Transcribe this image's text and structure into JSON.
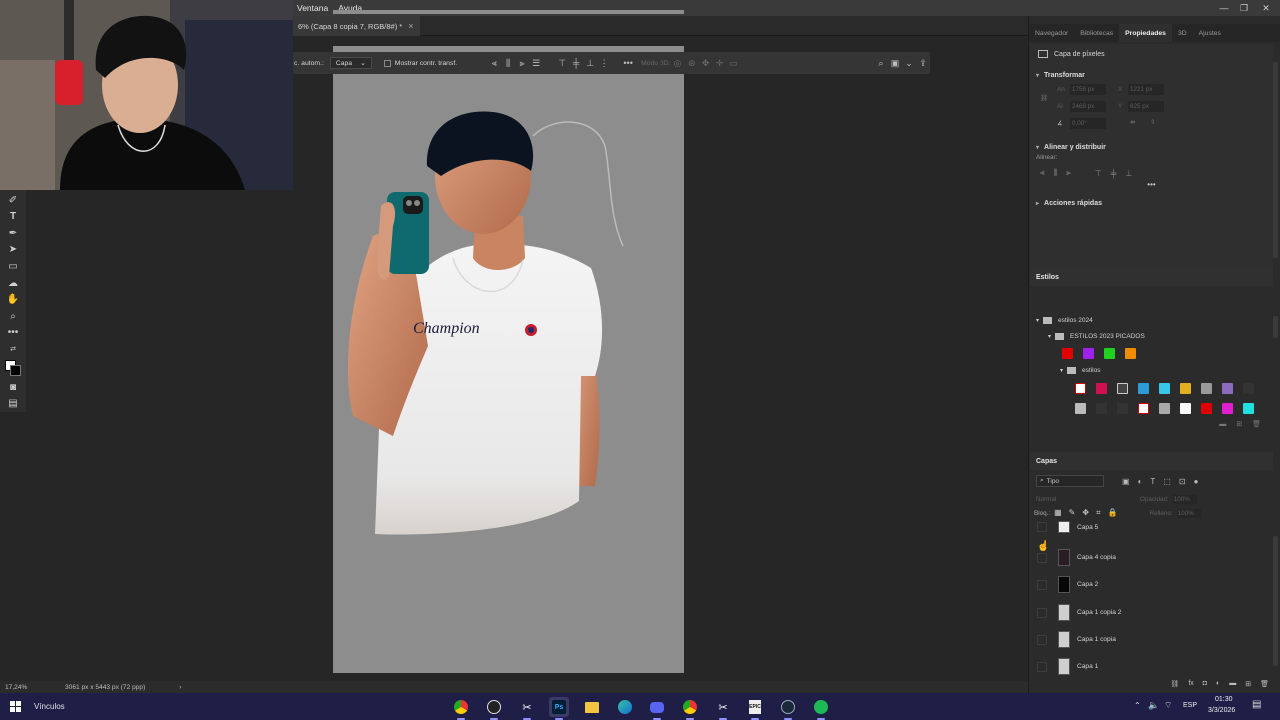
{
  "menubar": {
    "items": [
      "Ventana",
      "Ayuda"
    ]
  },
  "document": {
    "tab_title": "6% (Capa 8 copia 7, RGB/8#) *",
    "close_label": "×"
  },
  "context_bar": {
    "auto_select_label": "c. autom.:",
    "auto_select_value": "Capa",
    "show_transform_label": "Mostrar contr. transf.",
    "mode3d_label": "Modo 3D:"
  },
  "status": {
    "zoom": "17,24%",
    "doc_size": "3061 px x 5443 px (72 ppp)"
  },
  "panels": {
    "top_tabs": [
      "Navegador",
      "Bibliotecas",
      "Propiedades",
      "3D",
      "Ajustes"
    ],
    "active_top_tab": "Propiedades",
    "properties": {
      "layer_type": "Capa de píxeles",
      "transform_title": "Transformar",
      "w_label": "An",
      "w_value": "1756 px",
      "x_label": "X",
      "x_value": "1221 px",
      "h_label": "Al",
      "h_value": "2469 px",
      "y_label": "Y",
      "y_value": "625 px",
      "angle_value": "0,00°",
      "align_title": "Alinear y distribuir",
      "align_label": "Alinear:",
      "quick_actions_title": "Acciones rápidas"
    },
    "styles": {
      "title": "Estilos",
      "folder1": "estilos 2024",
      "folder2": "ESTILOS 2023 PICADOS",
      "folder3": "estilos"
    },
    "layers": {
      "title": "Capas",
      "filter": "Tipo",
      "blend_mode": "Normal",
      "opacity_label": "Opacidad:",
      "opacity_value": "100%",
      "lock_label": "Bloq.:",
      "fill_label": "Relleno:",
      "fill_value": "100%",
      "items": [
        "Capa 5",
        "Capa 4 copia",
        "Capa 2",
        "Capa 1 copia 2",
        "Capa 1 copia",
        "Capa 1"
      ]
    }
  },
  "taskbar": {
    "search_label": "Vínculos",
    "lang": "ESP",
    "time": "01:30",
    "date": "3/3/2026"
  },
  "colors": {
    "taskbar": "#1f1e47",
    "ui_bg": "#2b2b2b",
    "canvas_bg": "#8d8d8d",
    "swatch_red": "#e20000",
    "swatch_purple": "#a020f0",
    "swatch_green": "#1fd21f",
    "swatch_orange": "#f08c00"
  }
}
